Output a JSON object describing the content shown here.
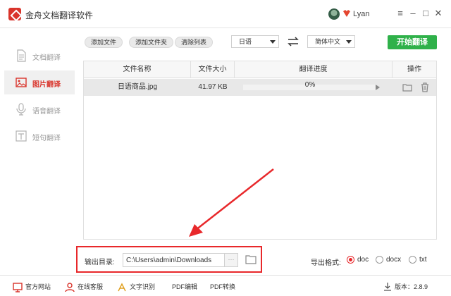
{
  "window": {
    "title": "金舟文档翻译软件",
    "username": "Lyan",
    "min_label": "–",
    "max_label": "□",
    "close_label": "✕",
    "menu_label": "≡"
  },
  "sidebar": {
    "items": [
      {
        "label": "文档翻译",
        "icon": "document-icon",
        "active": false
      },
      {
        "label": "图片翻译",
        "icon": "image-icon",
        "active": true
      },
      {
        "label": "语音翻译",
        "icon": "microphone-icon",
        "active": false
      },
      {
        "label": "短句翻译",
        "icon": "text-icon",
        "active": false
      }
    ]
  },
  "toolbar": {
    "add_file": "添加文件",
    "add_folder": "添加文件夹",
    "clear_list": "清除列表",
    "source_lang": "日语",
    "target_lang": "简体中文",
    "start": "开始翻译"
  },
  "table": {
    "headers": [
      "文件名称",
      "文件大小",
      "翻译进度",
      "操作"
    ],
    "rows": [
      {
        "name": "日语商品.jpg",
        "size": "41.97 KB",
        "progress_label": "0%",
        "progress": 0
      }
    ]
  },
  "output": {
    "label": "输出目录:",
    "path": "C:\\Users\\admin\\Downloads",
    "browse": "···"
  },
  "export": {
    "label": "导出格式:",
    "options": [
      "doc",
      "docx",
      "txt"
    ],
    "selected": "doc"
  },
  "footer": {
    "items": [
      "官方网站",
      "在线客服",
      "文字识别",
      "PDF编辑",
      "PDF转换"
    ],
    "version": "版本：2.8.9"
  },
  "colors": {
    "brand": "#d9342b",
    "start_button": "#2fb14a",
    "annotation": "#e8282b"
  }
}
